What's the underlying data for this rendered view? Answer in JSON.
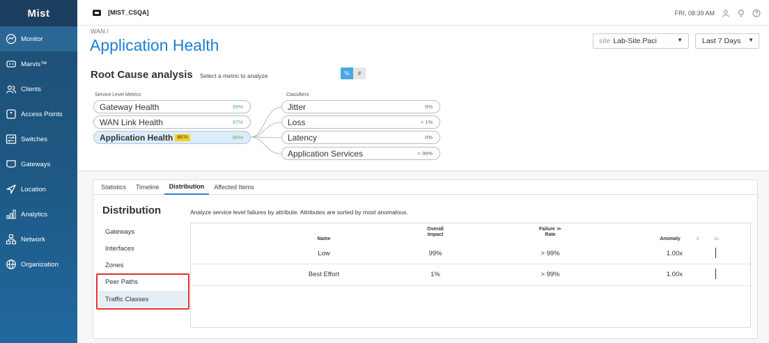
{
  "logo": "Mist",
  "nav": {
    "items": [
      {
        "label": "Monitor",
        "icon": "monitor-icon"
      },
      {
        "label": "Marvis™",
        "icon": "marvis-icon"
      },
      {
        "label": "Clients",
        "icon": "clients-icon"
      },
      {
        "label": "Access Points",
        "icon": "access-point-icon"
      },
      {
        "label": "Switches",
        "icon": "switch-icon"
      },
      {
        "label": "Gateways",
        "icon": "gateway-icon"
      },
      {
        "label": "Location",
        "icon": "location-icon"
      },
      {
        "label": "Analytics",
        "icon": "analytics-icon"
      },
      {
        "label": "Network",
        "icon": "network-icon"
      },
      {
        "label": "Organization",
        "icon": "organization-icon"
      }
    ]
  },
  "topbar": {
    "org_name": "[MIST_CSQA]",
    "clock": "FRI, 08:39 AM"
  },
  "header": {
    "breadcrumb": "WAN /",
    "title": "Application Health",
    "site_prefix": "site",
    "site_value": "Lab-Site.Paci",
    "date_range": "Last 7 Days"
  },
  "rca": {
    "title": "Root Cause analysis",
    "subtitle": "Select a metric to analyze",
    "toggle_percent": "%",
    "toggle_count": "#",
    "slm_label": "Service Level Metrics",
    "classifiers_label": "Classifiers",
    "metrics": [
      {
        "name": "Gateway Health",
        "value": "99%"
      },
      {
        "name": "WAN Link Health",
        "value": "97%"
      },
      {
        "name": "Application Health",
        "value": "85%",
        "badge": "BETA"
      }
    ],
    "classifiers": [
      {
        "name": "Jitter",
        "value": "0%"
      },
      {
        "name": "Loss",
        "value": "< 1%"
      },
      {
        "name": "Latency",
        "value": "0%"
      },
      {
        "name": "Application Services",
        "value": "> 99%"
      }
    ]
  },
  "tabs": [
    "Statistics",
    "Timeline",
    "Distribution",
    "Affected Items"
  ],
  "distribution": {
    "title": "Distribution",
    "description": "Analyze service level failures by attribute. Attributes are sorted by most anomalous.",
    "attributes": [
      "Gateways",
      "Interfaces",
      "Zones",
      "Peer Paths",
      "Traffic Classes"
    ],
    "columns": {
      "name": "Name",
      "impact_1": "Overall",
      "impact_2": "Impact",
      "failure_1": "Failure",
      "failure_2": "Rate",
      "anomaly": "Anomaly",
      "axis_min": "0",
      "axis_max": "1x"
    },
    "rows": [
      {
        "name": "Low",
        "impact": "99%",
        "failure": "> 99%",
        "anomaly": "1.00x"
      },
      {
        "name": "Best Effort",
        "impact": "1%",
        "failure": "> 99%",
        "anomaly": "1.00x"
      }
    ]
  },
  "colors": {
    "accent": "#1c7fd1",
    "sidebar": "#1f4d73",
    "highlight": "#e0322f",
    "good": "#5cb85c"
  }
}
